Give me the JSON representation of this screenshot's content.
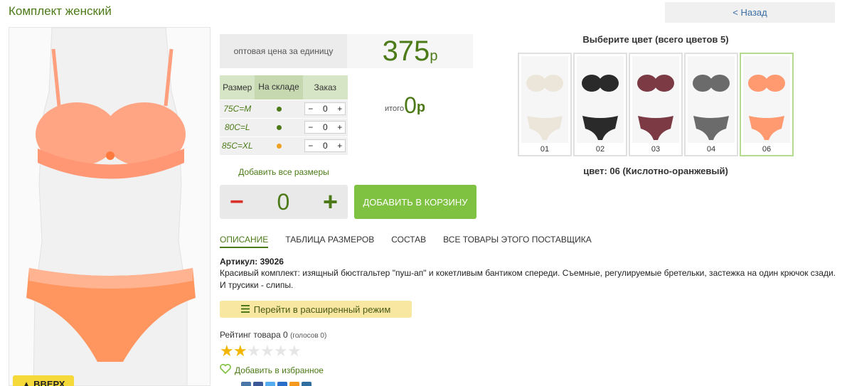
{
  "page": {
    "title": "Комплект женский",
    "back_label": "< Назад",
    "to_top_label": "▲ ВВЕРХ"
  },
  "price": {
    "label": "оптовая цена за единицу",
    "value": "375",
    "currency": "р"
  },
  "sizes": {
    "headers": [
      "Размер",
      "На складе",
      "Заказ"
    ],
    "rows": [
      {
        "size": "75C=M",
        "stock_color": "#4c7a18",
        "qty": "0"
      },
      {
        "size": "80C=L",
        "stock_color": "#4c7a18",
        "qty": "0"
      },
      {
        "size": "85C=XL",
        "stock_color": "#f0a020",
        "qty": "0"
      }
    ],
    "add_all_label": "Добавить все размеры"
  },
  "total": {
    "label": "итого",
    "value": "0",
    "currency": "р"
  },
  "quantity": {
    "value": "0",
    "minus": "−",
    "plus": "+"
  },
  "cart": {
    "add_label": "ДОБАВИТЬ В КОРЗИНУ"
  },
  "colors": {
    "title": "Выберите цвет (всего цветов 5)",
    "items": [
      {
        "num": "01",
        "color": "#ece6da"
      },
      {
        "num": "02",
        "color": "#2a2a2a"
      },
      {
        "num": "03",
        "color": "#7b3a44"
      },
      {
        "num": "04",
        "color": "#6b6b6b"
      },
      {
        "num": "06",
        "color": "#ff9a70"
      }
    ],
    "selected_label": "цвет: 06 (Кислотно-оранжевый)"
  },
  "tabs": [
    {
      "label": "ОПИСАНИЕ"
    },
    {
      "label": "ТАБЛИЦА РАЗМЕРОВ"
    },
    {
      "label": "СОСТАВ"
    },
    {
      "label": "ВСЕ ТОВАРЫ ЭТОГО ПОСТАВЩИКА"
    }
  ],
  "description": {
    "article": "Артикул: 39026",
    "text": "Красивый комплект: изящный бюстгальтер \"пуш-ап\" и кокетливым бантиком спереди. Съемные, регулируемые бретельки, застежка на один крючок сзади. И трусики - слипы."
  },
  "extended_mode": {
    "label": "Перейти в расширенный режим"
  },
  "rating": {
    "label": "Рейтинг товара",
    "value": "0",
    "votes": "(голосов 0)",
    "stars": 2
  },
  "favorite": {
    "label": "Добавить в избранное"
  },
  "colors_theme": {
    "accent": "#4c7a18",
    "cart_button": "#7fc241",
    "price_bg": "#f6f6f6"
  }
}
